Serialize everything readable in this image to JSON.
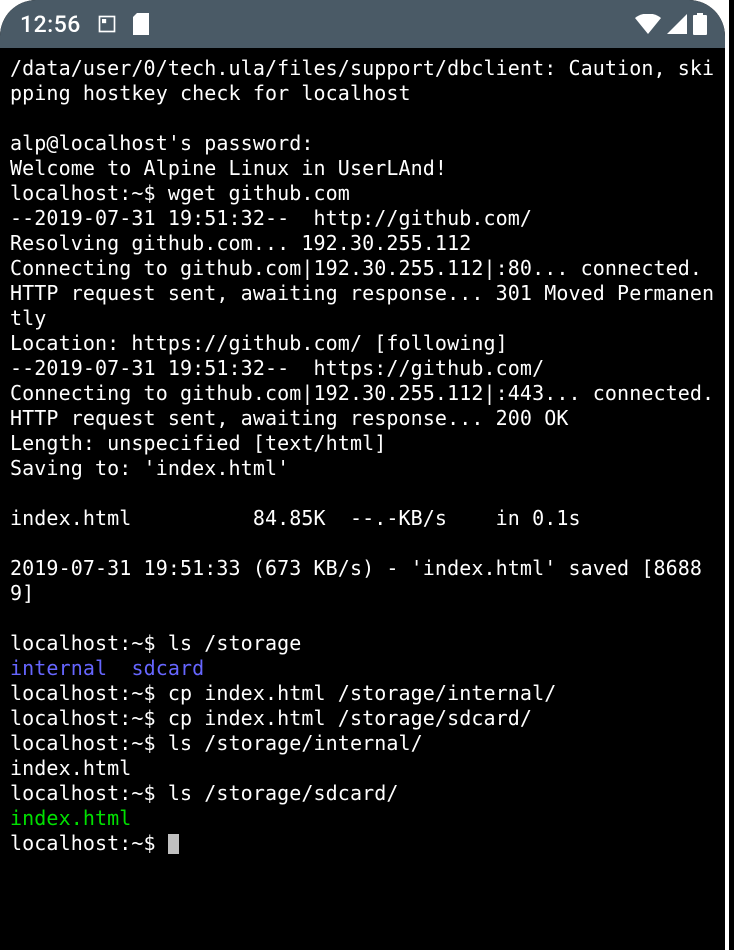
{
  "statusbar": {
    "clock": "12:56",
    "icons_left": [
      "aspect-ratio-icon",
      "sd-card-icon"
    ],
    "icons_right": [
      "wifi-icon",
      "cell-signal-icon",
      "battery-icon"
    ]
  },
  "terminal": {
    "lines": [
      {
        "text": "/data/user/0/tech.ula/files/support/dbclient: Caution, skipping hostkey check for localhost"
      },
      {
        "text": ""
      },
      {
        "text": "alp@localhost's password:"
      },
      {
        "text": "Welcome to Alpine Linux in UserLAnd!"
      },
      {
        "text": "localhost:~$ wget github.com"
      },
      {
        "text": "--2019-07-31 19:51:32--  http://github.com/"
      },
      {
        "text": "Resolving github.com... 192.30.255.112"
      },
      {
        "text": "Connecting to github.com|192.30.255.112|:80... connected."
      },
      {
        "text": "HTTP request sent, awaiting response... 301 Moved Permanently"
      },
      {
        "text": "Location: https://github.com/ [following]"
      },
      {
        "text": "--2019-07-31 19:51:32--  https://github.com/"
      },
      {
        "text": "Connecting to github.com|192.30.255.112|:443... connected."
      },
      {
        "text": "HTTP request sent, awaiting response... 200 OK"
      },
      {
        "text": "Length: unspecified [text/html]"
      },
      {
        "text": "Saving to: 'index.html'"
      },
      {
        "text": ""
      },
      {
        "text": "index.html          84.85K  --.-KB/s    in 0.1s"
      },
      {
        "text": ""
      },
      {
        "text": "2019-07-31 19:51:33 (673 KB/s) - 'index.html' saved [86889]"
      },
      {
        "text": ""
      },
      {
        "text": "localhost:~$ ls /storage"
      },
      {
        "segments": [
          {
            "t": "internal",
            "c": "blue"
          },
          {
            "t": "  "
          },
          {
            "t": "sdcard",
            "c": "blue"
          }
        ]
      },
      {
        "text": "localhost:~$ cp index.html /storage/internal/"
      },
      {
        "text": "localhost:~$ cp index.html /storage/sdcard/"
      },
      {
        "text": "localhost:~$ ls /storage/internal/"
      },
      {
        "text": "index.html"
      },
      {
        "text": "localhost:~$ ls /storage/sdcard/"
      },
      {
        "segments": [
          {
            "t": "index.html",
            "c": "green"
          }
        ]
      },
      {
        "prompt": "localhost:~$ ",
        "cursor": true
      }
    ]
  }
}
